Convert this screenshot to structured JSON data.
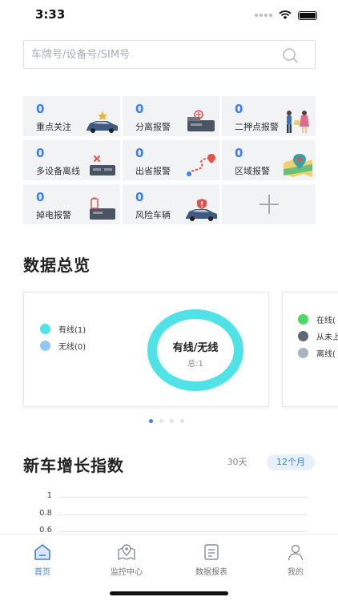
{
  "status_bar": {
    "time": "3:33"
  },
  "search": {
    "placeholder": "车牌号/设备号/SIM号"
  },
  "alarms": [
    {
      "count": "0",
      "label": "重点关注",
      "icon": "car-star-icon"
    },
    {
      "count": "0",
      "label": "分离报警",
      "icon": "device-separate-icon"
    },
    {
      "count": "0",
      "label": "二押点报警",
      "icon": "people-meeting-icon"
    },
    {
      "count": "0",
      "label": "多设备离线",
      "icon": "multi-device-offline-icon"
    },
    {
      "count": "0",
      "label": "出省报警",
      "icon": "route-out-province-icon"
    },
    {
      "count": "0",
      "label": "区域报警",
      "icon": "map-area-icon"
    },
    {
      "count": "0",
      "label": "掉电报警",
      "icon": "battery-power-off-icon"
    },
    {
      "count": "0",
      "label": "风险车辆",
      "icon": "car-shield-icon"
    }
  ],
  "add_card": {
    "icon": "plus-icon"
  },
  "overview": {
    "title": "数据总览",
    "card1": {
      "legend": [
        {
          "label": "有线(1)",
          "color": "#4fe3e8"
        },
        {
          "label": "无线(0)",
          "color": "#93c7f5"
        }
      ],
      "center_title": "有线/无线",
      "center_sub": "总:1",
      "values": [
        1,
        0
      ]
    },
    "card2": {
      "legend": [
        {
          "label": "在线(",
          "color": "#4cd964"
        },
        {
          "label": "从未上",
          "color": "#5e6873"
        },
        {
          "label": "离线(",
          "color": "#a9b2bf"
        }
      ]
    },
    "pager": {
      "count": 4,
      "active": 0
    }
  },
  "growth": {
    "title": "新车增长指数",
    "ranges": [
      "30天",
      "12个月"
    ],
    "active_range": "12个月",
    "chart_data": {
      "type": "line",
      "y_ticks": [
        "1",
        "0.8",
        "0.6"
      ],
      "ylim": [
        0,
        1
      ],
      "series": []
    }
  },
  "tabs": [
    {
      "label": "首页",
      "icon": "home-icon",
      "active": true
    },
    {
      "label": "监控中心",
      "icon": "map-pin-icon",
      "active": false
    },
    {
      "label": "数据报表",
      "icon": "report-icon",
      "active": false
    },
    {
      "label": "我的",
      "icon": "user-icon",
      "active": false
    }
  ],
  "colors": {
    "accent": "#3b7ff0",
    "card_bg": "#f2f3f5"
  }
}
